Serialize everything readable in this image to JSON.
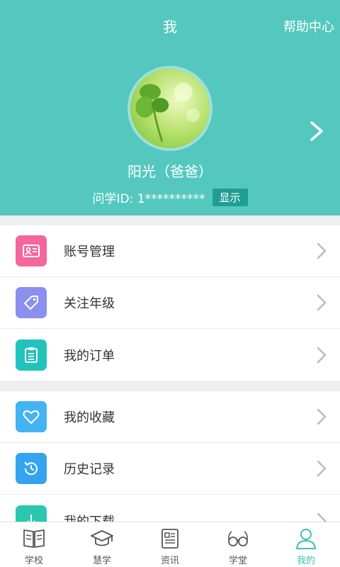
{
  "header": {
    "title": "我",
    "help": "帮助中心",
    "username": "阳光（爸爸）",
    "id_label": "问学ID: 1**********",
    "show_button": "显示"
  },
  "colors": {
    "primary": "#54c8be",
    "account_icon": "#f5669a",
    "grade_icon": "#8a8ff0",
    "order_icon": "#22c3bd",
    "favorite_icon": "#44b3f3",
    "history_icon": "#35a3f0",
    "download_icon": "#2bc6b0"
  },
  "groups": [
    {
      "items": [
        {
          "label": "账号管理",
          "icon": "id-card-icon"
        },
        {
          "label": "关注年级",
          "icon": "tag-icon"
        },
        {
          "label": "我的订单",
          "icon": "clipboard-icon"
        }
      ]
    },
    {
      "items": [
        {
          "label": "我的收藏",
          "icon": "heart-icon"
        },
        {
          "label": "历史记录",
          "icon": "history-icon"
        },
        {
          "label": "我的下载",
          "icon": "download-icon"
        }
      ]
    }
  ],
  "tabbar": {
    "items": [
      {
        "label": "学校",
        "icon": "book-icon"
      },
      {
        "label": "慧学",
        "icon": "graduation-cap-icon"
      },
      {
        "label": "资讯",
        "icon": "news-icon"
      },
      {
        "label": "学堂",
        "icon": "glasses-icon"
      },
      {
        "label": "我的",
        "icon": "user-icon",
        "active": true
      }
    ]
  }
}
